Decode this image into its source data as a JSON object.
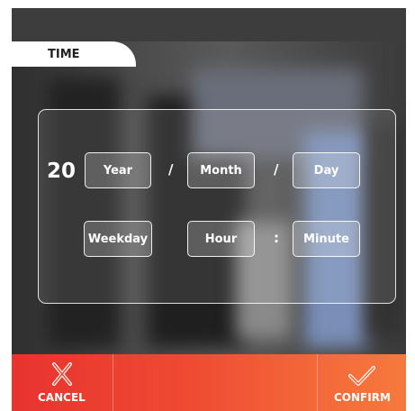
{
  "header": {
    "tab_label": "TIME"
  },
  "date_time": {
    "year_prefix": "20",
    "year_label": "Year",
    "month_label": "Month",
    "day_label": "Day",
    "date_separator": "/",
    "weekday_label": "Weekday",
    "hour_label": "Hour",
    "minute_label": "Minute",
    "time_separator": ":"
  },
  "actions": {
    "cancel_label": "CANCEL",
    "confirm_label": "CONFIRM",
    "cancel_icon": "x-icon",
    "confirm_icon": "check-icon"
  },
  "colors": {
    "action_bar_start": "#e8332f",
    "action_bar_end": "#f6793c"
  }
}
